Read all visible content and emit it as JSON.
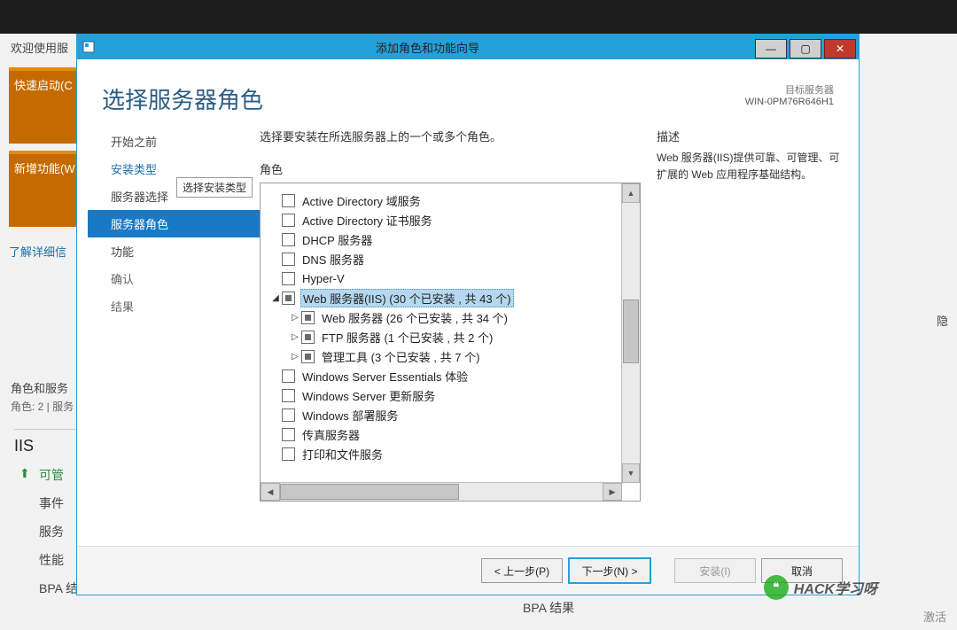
{
  "sm": {
    "welcome": "欢迎使用服",
    "block1": "快速启动(C",
    "block2": "新增功能(W",
    "detailLink": "了解详细信",
    "panelHead": "角色和服务",
    "panelSub": "角色: 2 | 服务",
    "iisTitle": "IIS",
    "items": {
      "i0": "可管",
      "i1": "事件",
      "i2": "服务",
      "i3": "性能",
      "i4": "BPA 结果"
    },
    "bpaRight": "BPA 结果",
    "activate": "激活",
    "hide": "隐"
  },
  "wizard": {
    "title": "添加角色和功能向导",
    "heading": "选择服务器角色",
    "targetLabel": "目标服务器",
    "targetValue": "WIN-0PM76R646H1",
    "nav": {
      "n0": "开始之前",
      "n1": "安装类型",
      "n2": "服务器选择",
      "n3": "服务器角色",
      "n4": "功能",
      "n5": "确认",
      "n6": "结果",
      "tooltip": "选择安装类型"
    },
    "instruction": "选择要安装在所选服务器上的一个或多个角色。",
    "rolesLabel": "角色",
    "descLabel": "描述",
    "descText": "Web 服务器(IIS)提供可靠、可管理、可扩展的 Web 应用程序基础结构。",
    "roles": {
      "r0": "Active Directory 域服务",
      "r1": "Active Directory 证书服务",
      "r2": "DHCP 服务器",
      "r3": "DNS 服务器",
      "r4": "Hyper-V",
      "r5": "Web 服务器(IIS) (30 个已安装 , 共 43 个)",
      "r6": "Web 服务器 (26 个已安装 , 共 34 个)",
      "r7": "FTP 服务器 (1 个已安装 , 共 2 个)",
      "r8": "管理工具 (3 个已安装 , 共 7 个)",
      "r9": "Windows Server Essentials 体验",
      "r10": "Windows Server 更新服务",
      "r11": "Windows 部署服务",
      "r12": "传真服务器",
      "r13": "打印和文件服务"
    },
    "buttons": {
      "prev": "< 上一步(P)",
      "next": "下一步(N) >",
      "install": "安装(I)",
      "cancel": "取消"
    }
  },
  "watermark": "HACK学习呀"
}
